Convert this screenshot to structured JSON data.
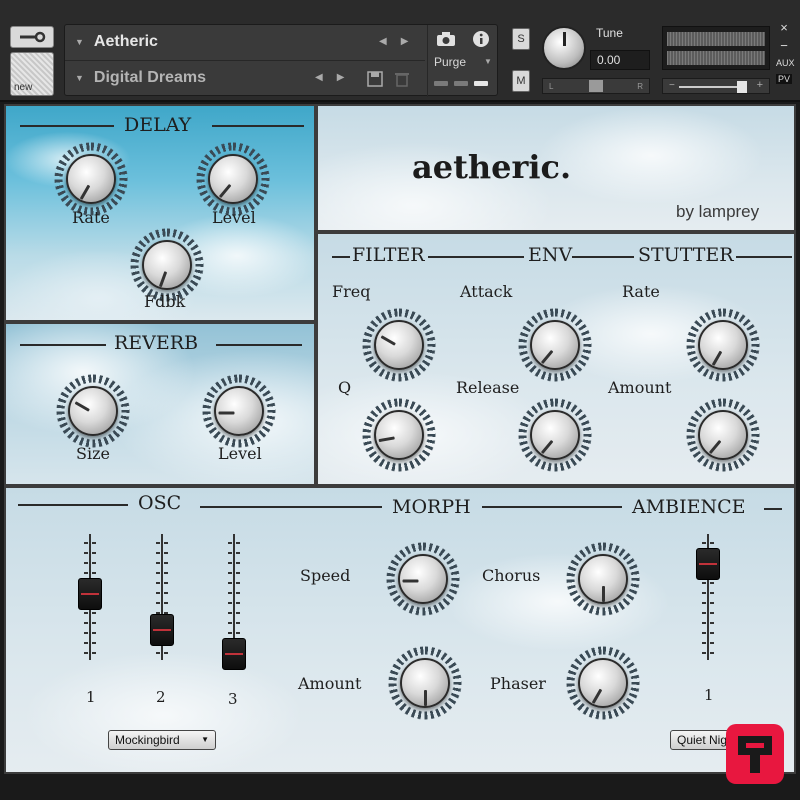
{
  "header": {
    "instrument_name": "Aetheric",
    "snapshot_name": "Digital Dreams",
    "new_label": "new",
    "purge_label": "Purge",
    "solo_label": "S",
    "mute_label": "M",
    "tune_label": "Tune",
    "tune_value": "0.00",
    "pan_left": "L",
    "pan_right": "R",
    "vol_minus": "−",
    "vol_plus": "+",
    "close_label": "×",
    "minimize_label": "−",
    "aux_label": "AUX",
    "pv_label": "PV"
  },
  "title": {
    "main": "aetheric.",
    "byline": "by lamprey"
  },
  "delay": {
    "title": "DELAY",
    "rate_label": "Rate",
    "level_label": "Level",
    "fdbk_label": "Fdbk"
  },
  "reverb": {
    "title": "REVERB",
    "size_label": "Size",
    "level_label": "Level"
  },
  "mod": {
    "filter_title": "FILTER",
    "env_title": "ENV",
    "stutter_title": "STUTTER",
    "freq_label": "Freq",
    "q_label": "Q",
    "attack_label": "Attack",
    "release_label": "Release",
    "rate_label": "Rate",
    "amount_label": "Amount"
  },
  "bottom": {
    "osc_title": "OSC",
    "morph_title": "MORPH",
    "ambience_title": "AMBIENCE",
    "speed_label": "Speed",
    "amount_label": "Amount",
    "chorus_label": "Chorus",
    "phaser_label": "Phaser",
    "osc_slider_labels": [
      "1",
      "2",
      "3"
    ],
    "ambience_slider_label": "1",
    "osc_preset": "Mockingbird",
    "ambience_preset": "Quiet Nigh"
  },
  "icons": {
    "wrench": "wrench-icon",
    "camera": "camera-icon",
    "info": "info-icon",
    "save": "save-icon",
    "trash": "trash-icon"
  }
}
